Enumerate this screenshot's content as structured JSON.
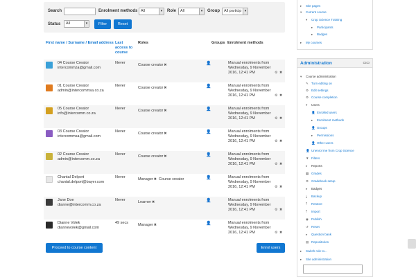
{
  "filter": {
    "search_label": "Search",
    "enrol_label": "Enrolment methods",
    "enrol_value": "All",
    "role_label": "Role",
    "role_value": "All",
    "group_label": "Group",
    "group_value": "All particip",
    "status_label": "Status",
    "status_value": "All",
    "filter_button": "Filter",
    "reset_button": "Reset"
  },
  "table": {
    "headers": {
      "first_name": "First name",
      "surname": "Surname",
      "email": "Email address",
      "last_access": "Last access to course",
      "roles": "Roles",
      "groups": "Groups",
      "enrolment": "Enrolment methods"
    },
    "rows": [
      {
        "name": "04 Course Creator",
        "email": "intercommza@gmail.com",
        "last": "Never",
        "roles": "Course creator",
        "enrol": [
          "Manual enrolments from",
          "Wednesday, 9 November",
          "2016, 12:41 PM"
        ],
        "avatar_color": "#3aa0d8"
      },
      {
        "name": "01 Course Creator",
        "email": "admin@intercommsa.co.za",
        "last": "Never",
        "roles": "Course creator",
        "enrol": [
          "Manual enrolments from",
          "Wednesday, 9 November",
          "2016, 12:41 PM"
        ],
        "avatar_color": "#e07b1f"
      },
      {
        "name": "05 Course Creator",
        "email": "info@intercomm.co.za",
        "last": "Never",
        "roles": "Course creator",
        "enrol": [
          "Manual enrolments from",
          "Wednesday, 9 November",
          "2016, 12:41 PM"
        ],
        "avatar_color": "#d4a020"
      },
      {
        "name": "03 Course Creator",
        "email": "intercommsa@gmail.com",
        "last": "Never",
        "roles": "Course creator",
        "enrol": [
          "Manual enrolments from",
          "Wednesday, 9 November",
          "2016, 12:41 PM"
        ],
        "avatar_color": "#8a5cc2"
      },
      {
        "name": "02 Course Creator",
        "email": "admin@intercomm.co.za",
        "last": "Never",
        "roles": "Course creator",
        "enrol": [
          "Manual enrolments from",
          "Wednesday, 9 November",
          "2016, 12:41 PM"
        ],
        "avatar_color": "#c9b23a"
      },
      {
        "name": "Chantal Delport",
        "email": "chantal.delport@bayer.com",
        "last": "Never",
        "roles": "Manager",
        "roles2": "Course creator",
        "enrol": [
          "Manual enrolments from",
          "Wednesday, 9 November",
          "2016, 12:41 PM"
        ],
        "avatar_color": "#e8e8e8"
      },
      {
        "name": "Jane Doe",
        "email": "dianne@intercomm.co.za",
        "last": "Never",
        "roles": "Learner",
        "enrol": [
          "Manual enrolments from",
          "Wednesday, 9 November",
          "2016, 12:41 PM"
        ],
        "avatar_color": "#3a3a3a"
      },
      {
        "name": "Dianne Volek",
        "email": "diannevolek@gmail.com",
        "last": "49 secs",
        "roles": "Manager",
        "enrol": [
          "Manual enrolments from",
          "Wednesday, 9 November",
          "2016, 12:41 PM"
        ],
        "avatar_color": "#2a2a2a"
      }
    ],
    "proceed_button": "Proceed to course content",
    "enrol_button": "Enrol users"
  },
  "nav_block": {
    "items": [
      "Site pages",
      "Current course",
      "Crop Science Training",
      "Participants",
      "Badges",
      "My courses"
    ]
  },
  "admin_block": {
    "title": "Administration",
    "items": [
      "Course administration",
      "Turn editing on",
      "Edit settings",
      "Course completion",
      "Users",
      "Enrolled users",
      "Enrolment methods",
      "Groups",
      "Permissions",
      "Other users",
      "Unenrol me from Crop Science",
      "Filters",
      "Reports",
      "Grades",
      "Gradebook setup",
      "Badges",
      "Backup",
      "Restore",
      "Import",
      "Publish",
      "Reset",
      "Question bank",
      "Repositories",
      "Switch role to...",
      "Site administration"
    ]
  }
}
